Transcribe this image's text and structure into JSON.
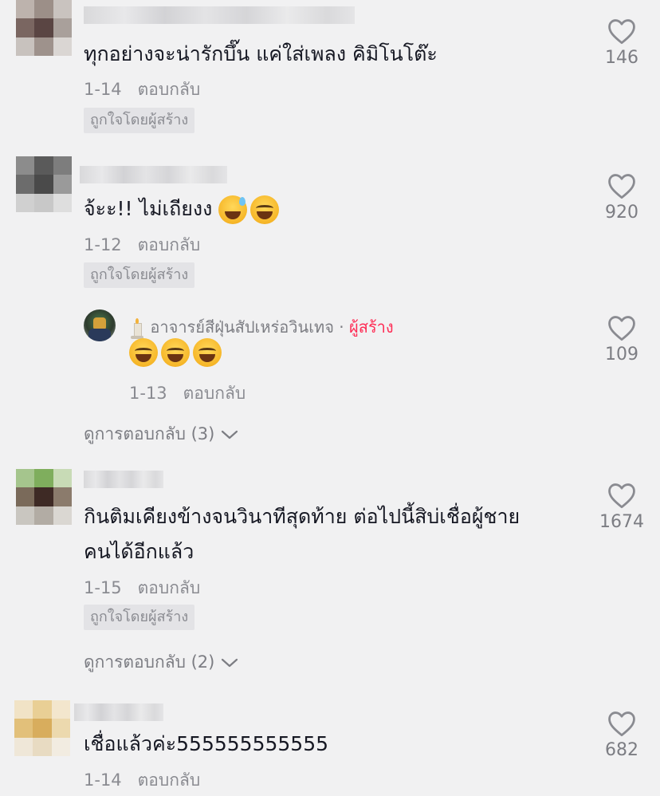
{
  "comments": [
    {
      "text": "ทุกอย่างจะน่ารักบึ๊น แค่ใส่เพลง คิมิโนโต๊ะ",
      "date": "1-14",
      "reply_label": "ตอบกลับ",
      "badge": "ถูกใจโดยผู้สร้าง",
      "likes": "146"
    },
    {
      "text": "จ้ะะ!! ไม่เถียงง",
      "date": "1-12",
      "reply_label": "ตอบกลับ",
      "badge": "ถูกใจโดยผู้สร้าง",
      "likes": "920",
      "reply": {
        "author": "อาจารย์สีฝุ่นสัปเหร่อวินเทจ",
        "separator": "·",
        "creator_tag": "ผู้สร้าง",
        "date": "1-13",
        "reply_label": "ตอบกลับ",
        "likes": "109"
      },
      "view_replies": "ดูการตอบกลับ (3)"
    },
    {
      "text_line1": "กินติมเคียงข้างจนวินาทีสุดท้าย ต่อไปนี้สิบ่เชื่อผู้ชาย",
      "text_line2": "คนได้อีกแล้ว",
      "date": "1-15",
      "reply_label": "ตอบกลับ",
      "badge": "ถูกใจโดยผู้สร้าง",
      "likes": "1674",
      "view_replies": "ดูการตอบกลับ (2)"
    },
    {
      "text": "เชื่อแล้วค่ะ555555555555",
      "date": "1-14",
      "reply_label": "ตอบกลับ",
      "likes": "682"
    }
  ],
  "icons": {
    "like": "heart-outline-icon",
    "chevron": "chevron-down-icon",
    "candle": "candle-icon"
  },
  "colors": {
    "background": "#f1f1f2",
    "text": "#161823",
    "muted": "#8a8b91",
    "creator": "#fe2c55"
  }
}
